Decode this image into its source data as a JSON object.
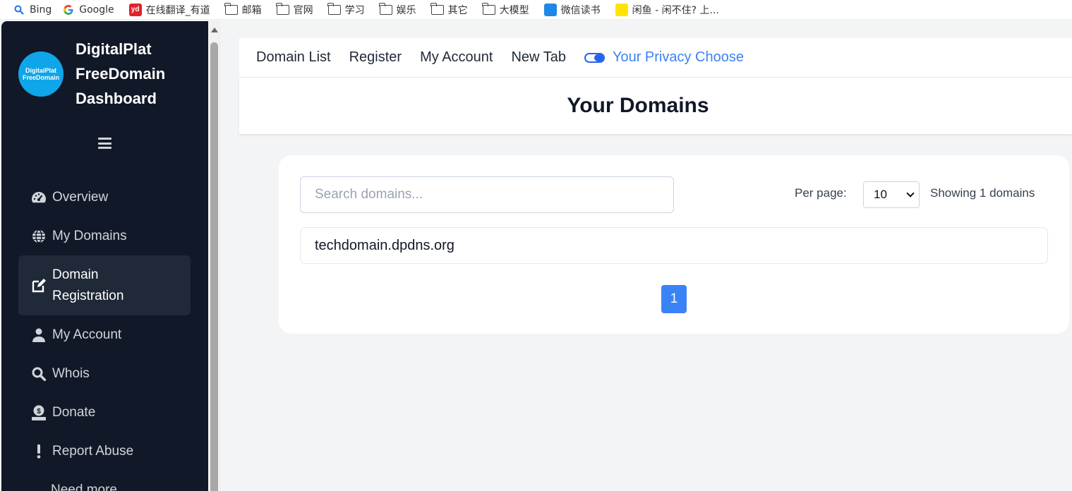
{
  "bookmarks": [
    {
      "label": "Bing",
      "icon": "bing-search-icon"
    },
    {
      "label": "Google",
      "icon": "google-icon"
    },
    {
      "label": "在线翻译_有道",
      "icon": "youdao-icon"
    },
    {
      "label": "邮箱",
      "icon": "folder-icon"
    },
    {
      "label": "官网",
      "icon": "folder-icon"
    },
    {
      "label": "学习",
      "icon": "folder-icon"
    },
    {
      "label": "娱乐",
      "icon": "folder-icon"
    },
    {
      "label": "其它",
      "icon": "folder-icon"
    },
    {
      "label": "大模型",
      "icon": "folder-icon"
    },
    {
      "label": "微信读书",
      "icon": "weread-icon"
    },
    {
      "label": "闲鱼 - 闲不住? 上...",
      "icon": "xianyu-icon"
    }
  ],
  "sidebar": {
    "logo_line1": "DigitalPlat",
    "logo_line2": "FreeDomain",
    "brand_line1": "DigitalPlat",
    "brand_line2": "FreeDomain",
    "brand_line3": "Dashboard",
    "items": [
      {
        "label": "Overview",
        "icon": "gauge-icon"
      },
      {
        "label": "My Domains",
        "icon": "globe-icon"
      },
      {
        "label": "Domain Registration",
        "icon": "edit-icon",
        "active": true
      },
      {
        "label": "My Account",
        "icon": "user-icon"
      },
      {
        "label": "Whois",
        "icon": "search-icon"
      },
      {
        "label": "Donate",
        "icon": "donate-icon"
      },
      {
        "label": "Report Abuse",
        "icon": "exclamation-icon"
      },
      {
        "label": "Need more",
        "icon": ""
      }
    ]
  },
  "topnav": {
    "links": [
      "Domain List",
      "Register",
      "My Account",
      "New Tab"
    ],
    "privacy_label": "Your Privacy Choose"
  },
  "page": {
    "title": "Your Domains"
  },
  "domains_panel": {
    "search_placeholder": "Search domains...",
    "per_page_label": "Per page:",
    "per_page_value": "10",
    "showing_text": "Showing 1 domains",
    "domains": [
      "techdomain.dpdns.org"
    ],
    "current_page": "1"
  },
  "colors": {
    "sidebar_bg": "#111827",
    "accent": "#3b82f6",
    "page_bg": "#f3f4f6"
  }
}
